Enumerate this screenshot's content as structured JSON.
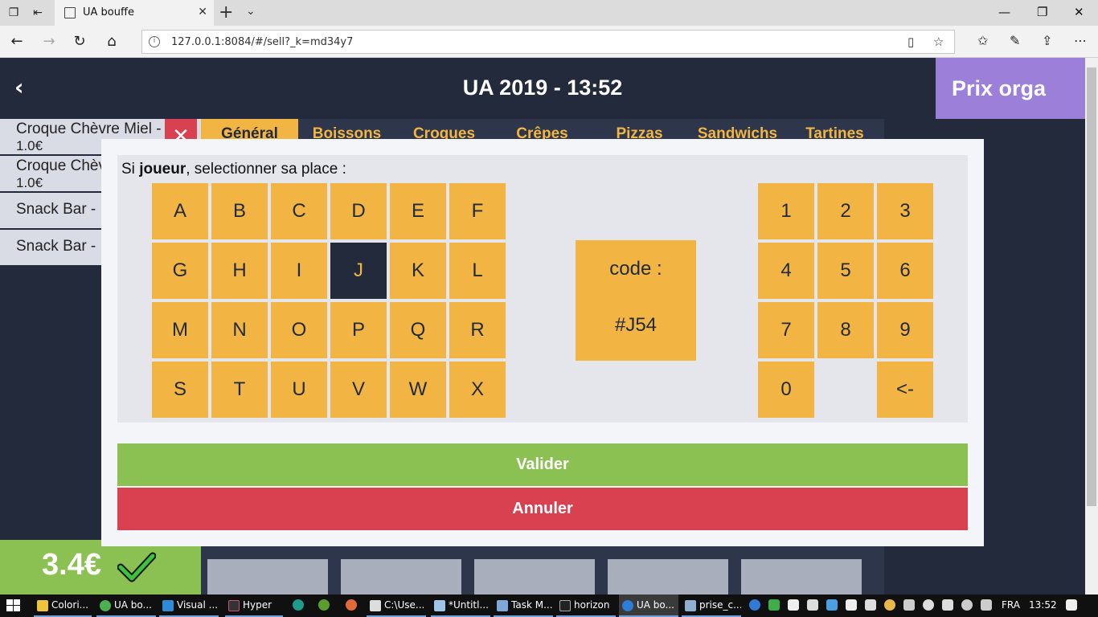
{
  "browser": {
    "tab_title": "UA bouffe",
    "url": "127.0.0.1:8084/#/sell?_k=md34y7"
  },
  "app": {
    "title": "UA 2019 - 13:52",
    "back_icon": "‹",
    "prix_orga": "Prix orga",
    "order_items": [
      {
        "name": "Croque Chèvre Miel -",
        "price": "1.0€"
      },
      {
        "name": "Croque Chèvre Miel -",
        "price": "1.0€"
      },
      {
        "name": "Snack Bar -",
        "price": ""
      },
      {
        "name": "Snack Bar -",
        "price": ""
      }
    ],
    "remove_icon": "✕",
    "categories": [
      "Général",
      "Boissons",
      "Croques",
      "Crêpes",
      "Pizzas",
      "Sandwichs",
      "Tartines"
    ],
    "active_category": "Général",
    "total": "3.4€"
  },
  "modal": {
    "prompt_prefix": "Si ",
    "prompt_bold": "joueur",
    "prompt_suffix": ", selectionner sa place :",
    "letters": [
      "A",
      "B",
      "C",
      "D",
      "E",
      "F",
      "G",
      "H",
      "I",
      "J",
      "K",
      "L",
      "M",
      "N",
      "O",
      "P",
      "Q",
      "R",
      "S",
      "T",
      "U",
      "V",
      "W",
      "X"
    ],
    "selected_letter": "J",
    "code_label": "code :",
    "code_value": "#J54",
    "digits": [
      "1",
      "2",
      "3",
      "4",
      "5",
      "6",
      "7",
      "8",
      "9",
      "0"
    ],
    "backspace": "<-",
    "validate": "Valider",
    "cancel": "Annuler"
  },
  "taskbar": {
    "items": [
      "Colori...",
      "UA bo...",
      "Visual ...",
      "Hyper",
      "C:\\Use...",
      "*Untitl...",
      "Task M...",
      "horizon",
      "UA bo...",
      "prise_c..."
    ],
    "lang": "FRA",
    "time": "13:52"
  },
  "colors": {
    "background": "#222a3b",
    "accent": "#f2b544",
    "valider": "#8bc152",
    "annuler": "#d94050",
    "prix_orga": "#9b7fd9"
  }
}
